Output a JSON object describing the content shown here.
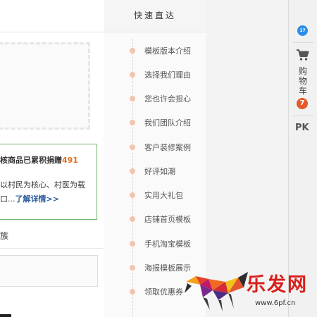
{
  "main": {
    "line1_text": "核商品已累积捐赠",
    "line1_number": "491",
    "line2_text": "以村民为核心、村医为载",
    "line3_text": "口...",
    "line3_link": "了解详情>>",
    "line4_text": "族"
  },
  "quicknav": {
    "title": "快速直达",
    "items": [
      {
        "label": "模板版本介绍"
      },
      {
        "label": "选择我们理由"
      },
      {
        "label": "您也许会担心"
      },
      {
        "label": "我们团队介绍"
      },
      {
        "label": "客户装修案例"
      },
      {
        "label": "好评如潮"
      },
      {
        "label": "实用大礼包"
      },
      {
        "label": "店铺首页模板"
      },
      {
        "label": "手机淘宝模板"
      },
      {
        "label": "海报模板展示"
      },
      {
        "label": "领取优惠券"
      }
    ],
    "dot_color": "#f3c5ae"
  },
  "toolbar": {
    "bubble_icon": "chat-bubble-icon",
    "bubble_text": "17",
    "cart_icon": "shopping-cart-icon",
    "cart_label_1": "购",
    "cart_label_2": "物",
    "cart_label_3": "车",
    "cart_count": "7",
    "pk_label": "PK"
  },
  "watermark": {
    "logo_icon": "polygon-bull-logo",
    "text": "乐发网",
    "url": "www.6pf.cn"
  },
  "colors": {
    "accent_orange": "#e4701e",
    "link_blue": "#2b5d9e",
    "green_border": "#6fb46f",
    "cart_badge": "#e35b2a",
    "watermark_red": "#d8201a"
  }
}
